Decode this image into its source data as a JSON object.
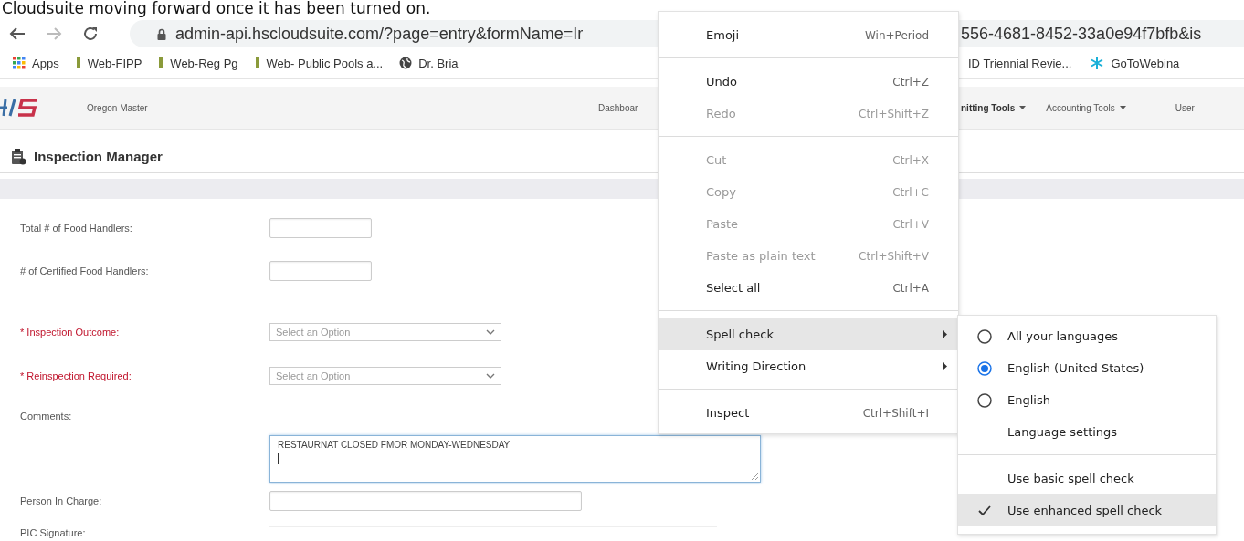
{
  "caption": "Cloudsuite moving forward once it has been turned on.",
  "browser": {
    "url_left": "admin-api.hscloudsuite.com/?page=entry&formName=Ir",
    "url_right": "556-4681-8452-33a0e94f7bfb&is"
  },
  "bookmarks_left": [
    {
      "kind": "apps",
      "label": "Apps"
    },
    {
      "kind": "bookmark",
      "label": "Web-FIPP"
    },
    {
      "kind": "bookmark",
      "label": "Web-Reg Pg"
    },
    {
      "kind": "bookmark",
      "label": "Web- Public Pools a..."
    },
    {
      "kind": "globe",
      "label": "Dr. Bria"
    }
  ],
  "bookmarks_right": [
    {
      "kind": "plain",
      "label": "ID Triennial Revie..."
    },
    {
      "kind": "snowflake",
      "label": "GoToWebina"
    }
  ],
  "app_header": {
    "brand": "Oregon Master",
    "nav_left": [
      {
        "label": "Dashboar",
        "dropdown": false
      }
    ],
    "nav_right": [
      {
        "label": "nitting Tools",
        "dropdown": true
      },
      {
        "label": "Accounting Tools",
        "dropdown": true
      },
      {
        "label": "User",
        "dropdown": false
      }
    ]
  },
  "page_title": "Inspection Manager",
  "form": [
    {
      "kind": "text",
      "label": "Total # of Food Handlers:",
      "required": false
    },
    {
      "kind": "text",
      "label": "# of Certified Food Handlers:",
      "required": false
    },
    {
      "kind": "select",
      "label": "* Inspection Outcome:",
      "required": true,
      "placeholder": "Select an Option"
    },
    {
      "kind": "select",
      "label": "* Reinspection Required:",
      "required": true,
      "placeholder": "Select an Option"
    },
    {
      "kind": "textarea",
      "label": "Comments:",
      "required": false,
      "value": "RESTAURNAT CLOSED FMOR MONDAY-WEDNESDAY"
    },
    {
      "kind": "wide",
      "label": "Person In Charge:",
      "required": false
    },
    {
      "kind": "signature",
      "label": "PIC Signature:",
      "required": false
    }
  ],
  "context_menu": [
    {
      "kind": "item",
      "label": "Emoji",
      "shortcut": "Win+Period",
      "disabled": false,
      "highlighted": false,
      "submenu": false
    },
    {
      "kind": "separator"
    },
    {
      "kind": "item",
      "label": "Undo",
      "shortcut": "Ctrl+Z",
      "disabled": false,
      "highlighted": false,
      "submenu": false
    },
    {
      "kind": "item",
      "label": "Redo",
      "shortcut": "Ctrl+Shift+Z",
      "disabled": true,
      "highlighted": false,
      "submenu": false
    },
    {
      "kind": "separator"
    },
    {
      "kind": "item",
      "label": "Cut",
      "shortcut": "Ctrl+X",
      "disabled": true,
      "highlighted": false,
      "submenu": false
    },
    {
      "kind": "item",
      "label": "Copy",
      "shortcut": "Ctrl+C",
      "disabled": true,
      "highlighted": false,
      "submenu": false
    },
    {
      "kind": "item",
      "label": "Paste",
      "shortcut": "Ctrl+V",
      "disabled": true,
      "highlighted": false,
      "submenu": false
    },
    {
      "kind": "item",
      "label": "Paste as plain text",
      "shortcut": "Ctrl+Shift+V",
      "disabled": true,
      "highlighted": false,
      "submenu": false
    },
    {
      "kind": "item",
      "label": "Select all",
      "shortcut": "Ctrl+A",
      "disabled": false,
      "highlighted": false,
      "submenu": false
    },
    {
      "kind": "separator"
    },
    {
      "kind": "item",
      "label": "Spell check",
      "disabled": false,
      "highlighted": true,
      "submenu": true
    },
    {
      "kind": "item",
      "label": "Writing Direction",
      "disabled": false,
      "highlighted": false,
      "submenu": true
    },
    {
      "kind": "separator"
    },
    {
      "kind": "item",
      "label": "Inspect",
      "shortcut": "Ctrl+Shift+I",
      "disabled": false,
      "highlighted": false,
      "submenu": false
    }
  ],
  "spell_submenu": [
    {
      "kind": "radio",
      "label": "All your languages",
      "selected": false,
      "highlighted": false
    },
    {
      "kind": "radio",
      "label": "English (United States)",
      "selected": true,
      "highlighted": false
    },
    {
      "kind": "radio",
      "label": "English",
      "selected": false,
      "highlighted": false
    },
    {
      "kind": "plain",
      "label": "Language settings",
      "highlighted": false
    },
    {
      "kind": "separator"
    },
    {
      "kind": "check",
      "label": "Use basic spell check",
      "checked": false,
      "highlighted": false
    },
    {
      "kind": "check",
      "label": "Use enhanced spell check",
      "checked": true,
      "highlighted": true
    }
  ]
}
